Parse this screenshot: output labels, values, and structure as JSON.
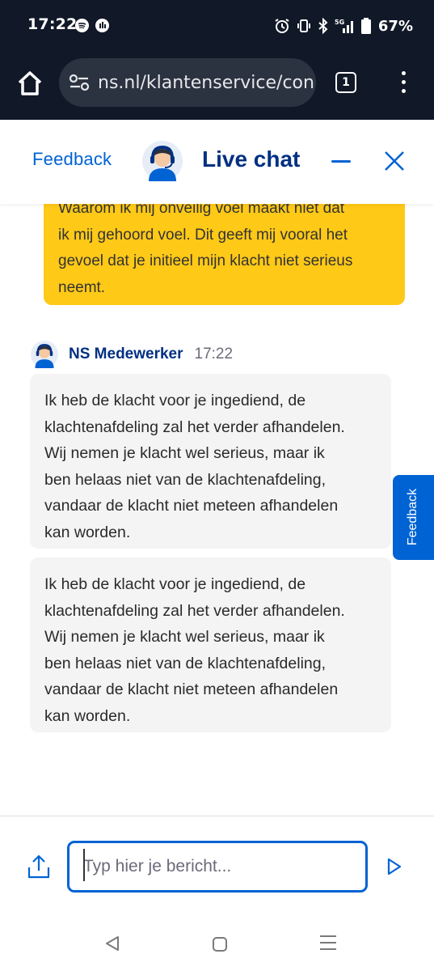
{
  "status_bar": {
    "time": "17:22",
    "battery_percent": "67%",
    "icons": [
      "spotify-icon",
      "app-icon",
      "alarm-icon",
      "vibrate-icon",
      "bluetooth-icon",
      "5g-signal-icon",
      "battery-icon"
    ]
  },
  "browser": {
    "url": "ns.nl/klantenservice/con",
    "tab_count": "1"
  },
  "chat_header": {
    "feedback_label": "Feedback",
    "title": "Live chat"
  },
  "messages": {
    "user_lines": [
      "Waarom ik mij onveilig voel maakt niet dat",
      "ik mij gehoord voel. Dit geeft mij vooral het",
      "gevoel dat je initieel mijn klacht niet serieus",
      "neemt."
    ],
    "agent_name": "NS Medewerker",
    "agent_time": "17:22",
    "agent_message_1": [
      "Ik heb de klacht voor je ingediend, de",
      "klachtenafdeling zal het verder afhandelen.",
      "Wij nemen je klacht wel serieus, maar ik",
      "ben helaas niet van de klachtenafdeling,",
      "vandaar de klacht niet meteen afhandelen",
      "kan worden."
    ],
    "agent_message_2": [
      "Ik heb de klacht voor je ingediend, de",
      "klachtenafdeling zal het verder afhandelen.",
      "Wij nemen je klacht wel serieus, maar ik",
      "ben helaas niet van de klachtenafdeling,",
      "vandaar de klacht niet meteen afhandelen",
      "kan worden."
    ]
  },
  "side_feedback_label": "Feedback",
  "composer": {
    "placeholder": "Typ hier je bericht...",
    "value": ""
  },
  "colors": {
    "ns_yellow": "#ffc917",
    "ns_blue": "#003082",
    "link_blue": "#0063d3",
    "dark_bar": "#111827"
  }
}
